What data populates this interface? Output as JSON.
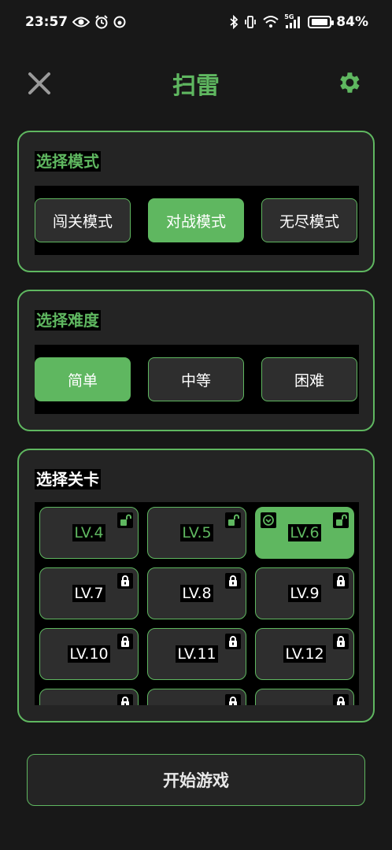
{
  "status_bar": {
    "time": "23:57",
    "network": "5G",
    "battery_percent": "84%"
  },
  "header": {
    "title": "扫雷"
  },
  "mode_section": {
    "title": "选择模式",
    "options": [
      {
        "label": "闯关模式",
        "selected": false
      },
      {
        "label": "对战模式",
        "selected": true
      },
      {
        "label": "无尽模式",
        "selected": false
      }
    ]
  },
  "difficulty_section": {
    "title": "选择难度",
    "options": [
      {
        "label": "简单",
        "selected": true
      },
      {
        "label": "中等",
        "selected": false
      },
      {
        "label": "困难",
        "selected": false
      }
    ]
  },
  "level_section": {
    "title": "选择关卡",
    "levels": [
      {
        "label": "LV.4",
        "state": "unlocked",
        "icon": "unlocked-icon"
      },
      {
        "label": "LV.5",
        "state": "unlocked",
        "icon": "unlocked-icon"
      },
      {
        "label": "LV.6",
        "state": "selected",
        "icon": "unlocked-icon",
        "badge": "current-icon"
      },
      {
        "label": "LV.7",
        "state": "locked",
        "icon": "lock-icon"
      },
      {
        "label": "LV.8",
        "state": "locked",
        "icon": "lock-icon"
      },
      {
        "label": "LV.9",
        "state": "locked",
        "icon": "lock-icon"
      },
      {
        "label": "LV.10",
        "state": "locked",
        "icon": "lock-icon"
      },
      {
        "label": "LV.11",
        "state": "locked",
        "icon": "lock-icon"
      },
      {
        "label": "LV.12",
        "state": "locked",
        "icon": "lock-icon"
      }
    ]
  },
  "start_button": {
    "label": "开始游戏"
  },
  "colors": {
    "accent": "#5fb760",
    "background": "#181818",
    "card": "#242424"
  }
}
